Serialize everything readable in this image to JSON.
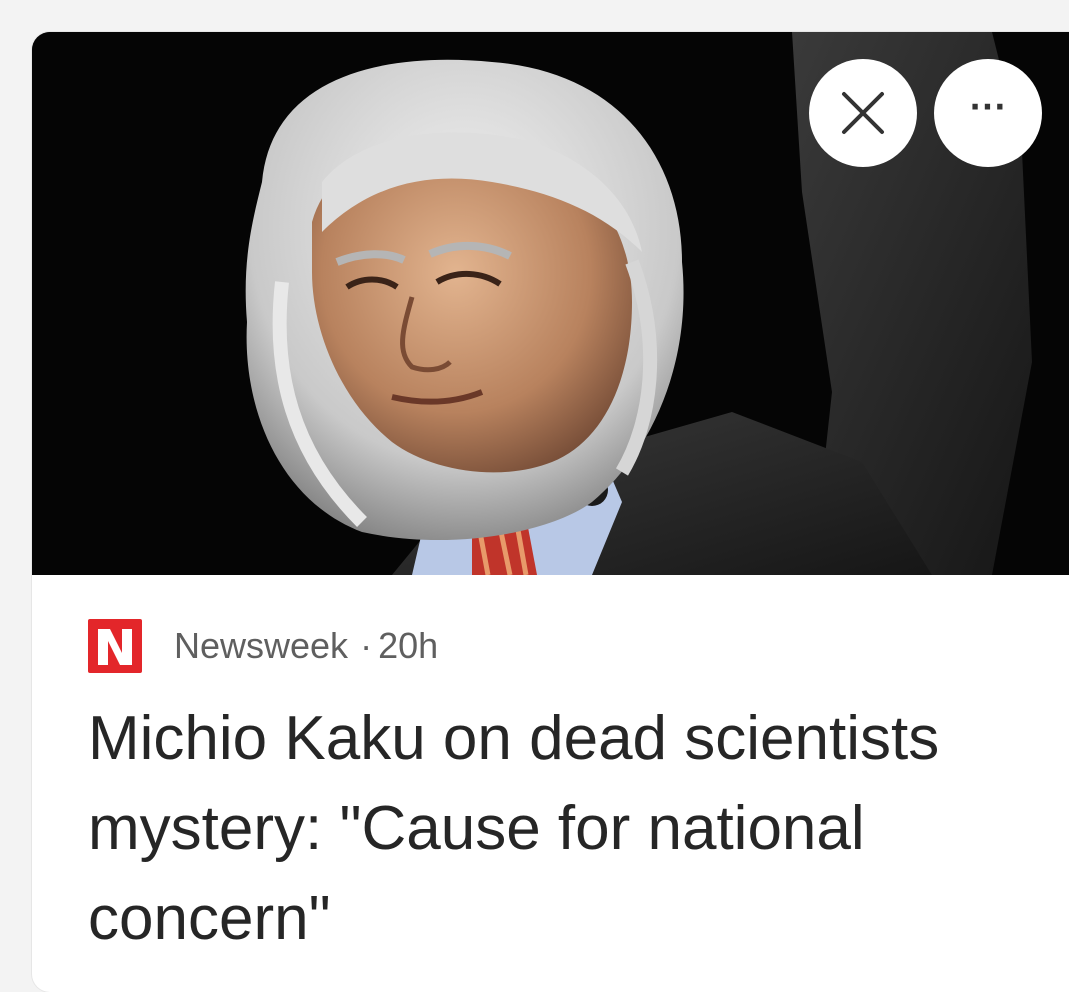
{
  "card": {
    "source_name": "Newsweek",
    "separator": "·",
    "age": "20h",
    "headline": "Michio Kaku on dead scientists mystery: \"Cause for national concern\"",
    "image_subject": "portrait-photo",
    "close_icon": "close-icon",
    "more_icon": "more-options-icon",
    "more_glyph": "···"
  },
  "colors": {
    "brand_red": "#e3262a",
    "headline_text": "#262626",
    "meta_text": "#5f5f5f",
    "image_background": "#050505"
  }
}
